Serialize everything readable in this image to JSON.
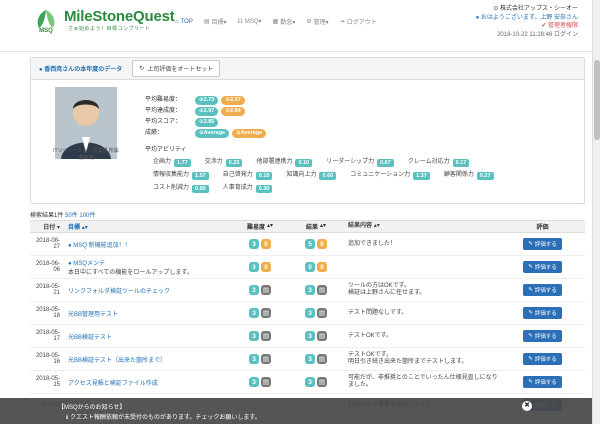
{
  "header": {
    "logo_text": "MSQ",
    "title": "MileStoneQuest",
    "subtitle": "さぁ始めよう！目標コンプリート",
    "nav": [
      {
        "label": "TOP",
        "icon": "home-icon"
      },
      {
        "label": "目標▾",
        "icon": "doc-icon"
      },
      {
        "label": "MSQ▾",
        "icon": "headset-icon"
      },
      {
        "label": "勤念▾",
        "icon": "list-icon"
      },
      {
        "label": "管理▾",
        "icon": "gear-icon"
      },
      {
        "label": "ログアウト",
        "icon": "logout-icon"
      }
    ],
    "company": "株式会社アップス・シーオー",
    "greeting": "おはようございます。上野 安奈さん",
    "admin": "管理者権限",
    "timestamp": "2018-10-22 11:28:46 ログイン"
  },
  "panel": {
    "title": "香西尭さんの本年度のデータ",
    "reset_label": "上司評価をオートセット",
    "caption_line1": "ITソリューション事業部 所属",
    "caption_line2": "香西尭",
    "metrics": [
      {
        "label": "平均難易度：",
        "pills": [
          {
            "text": "2.73",
            "kind": "t"
          },
          {
            "text": "2.37",
            "kind": "o"
          }
        ]
      },
      {
        "label": "平均達成度：",
        "pills": [
          {
            "text": "2.97",
            "kind": "t"
          },
          {
            "text": "2.84",
            "kind": "o"
          }
        ]
      },
      {
        "label": "平均スコア：",
        "pills": [
          {
            "text": "3.85",
            "kind": "t"
          }
        ]
      },
      {
        "label": "成績：",
        "pills": [
          {
            "text": "Average",
            "kind": "t"
          },
          {
            "text": "Average",
            "kind": "o"
          }
        ]
      }
    ],
    "ability_title": "平均アビリティ",
    "abilities": [
      {
        "label": "企画力",
        "value": "1.77"
      },
      {
        "label": "交渉力",
        "value": "0.23"
      },
      {
        "label": "他部署連携力",
        "value": "0.10"
      },
      {
        "label": "リーダーシップ力",
        "value": "0.67"
      },
      {
        "label": "クレーム対応力",
        "value": "0.17"
      },
      {
        "label": "情報収集能力",
        "value": "1.57"
      },
      {
        "label": "自己啓発力",
        "value": "0.10"
      },
      {
        "label": "知識向上力",
        "value": "0.60"
      },
      {
        "label": "コミュニケーション力",
        "value": "1.37"
      },
      {
        "label": "顧客関係力",
        "value": "0.27"
      },
      {
        "label": "コスト削減力",
        "value": "0.90"
      },
      {
        "label": "人事育成力",
        "value": "0.30"
      }
    ]
  },
  "results": {
    "count_text": "検索結果1件",
    "per_page_50": "50件",
    "per_page_100": "100件"
  },
  "table": {
    "headers": {
      "date": "日付",
      "title": "目標",
      "difficulty": "難易度",
      "result": "結果",
      "note": "結果内容",
      "eval": "評価"
    },
    "eval_label": "評価する",
    "rows": [
      {
        "date": "2018-08-27",
        "title": "MSQ 新機能追加！！",
        "sub": "",
        "d1": "3",
        "d2": "0",
        "d2kind": "o",
        "r1": "5",
        "r2": "0",
        "r2kind": "o",
        "note": "追加できました！",
        "note2": ""
      },
      {
        "date": "2018-06-06",
        "title": "MSQメンテ",
        "sub": "本日中にすべての機能をロールアップします。",
        "d1": "3",
        "d2": "0",
        "d2kind": "o",
        "r1": "0",
        "r2": "0",
        "r2kind": "o",
        "note": "",
        "note2": ""
      },
      {
        "date": "2018-05-21",
        "title": "リンクフォルダ検証ツールのチェック",
        "sub": "",
        "d1": "2",
        "d2": "▤",
        "d2kind": "g",
        "r1": "3",
        "r2": "▤",
        "r2kind": "g",
        "note": "ツールの方はOKです。",
        "note2": "検証は上野さんに任せます。"
      },
      {
        "date": "2018-05-18",
        "title": "光BB管理用テスト",
        "sub": "",
        "d1": "3",
        "d2": "▤",
        "d2kind": "g",
        "r1": "3",
        "r2": "▤",
        "r2kind": "g",
        "note": "テスト問題なしです。",
        "note2": ""
      },
      {
        "date": "2018-05-17",
        "title": "光BB検証テスト",
        "sub": "",
        "d1": "3",
        "d2": "▤",
        "d2kind": "g",
        "r1": "3",
        "r2": "▤",
        "r2kind": "g",
        "note": "テストOKです。",
        "note2": ""
      },
      {
        "date": "2018-05-16",
        "title": "光BB検証テスト（出来た箇所まで）",
        "sub": "",
        "d1": "3",
        "d2": "▤",
        "d2kind": "g",
        "r1": "3",
        "r2": "▤",
        "r2kind": "g",
        "note": "テストOKです。",
        "note2": "明日引き続き出来た箇所までテストします。"
      },
      {
        "date": "2018-05-15",
        "title": "アクセス見積と検証ファイル作成",
        "sub": "",
        "d1": "3",
        "d2": "▤",
        "d2kind": "g",
        "r1": "3",
        "r2": "▤",
        "r2kind": "g",
        "note": "可能だが、非推奨とのことでいったん仕様見直しになりました。",
        "note2": ""
      },
      {
        "date": "2018-0",
        "title": "",
        "sub": "",
        "d1": "",
        "d2": "",
        "d2kind": "g",
        "r1": "",
        "r2": "",
        "r2kind": "g",
        "note": "計画台外の事業を検証しました",
        "note2": ""
      }
    ]
  },
  "notice": {
    "title": "【MSQからのお知らせ】",
    "body": "クエスト報酬依頼が未受付のものがあります。チェックお願いします。",
    "close": "✖"
  },
  "colors": {
    "accent": "#2b8a3e",
    "link": "#1f6fb5",
    "teal": "#5bc0c0",
    "orange": "#f0ad4e",
    "button": "#2a6fb7"
  }
}
